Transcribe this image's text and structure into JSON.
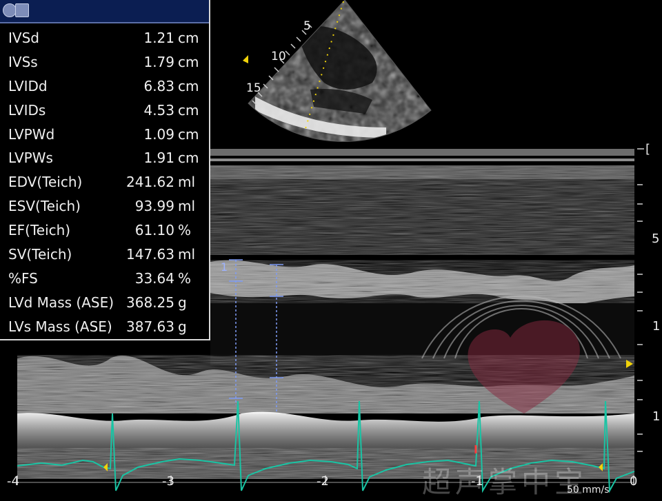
{
  "panel": {
    "header_icon": "report-icon",
    "rows": [
      {
        "label": "IVSd",
        "value": "1.21",
        "unit": "cm"
      },
      {
        "label": "IVSs",
        "value": "1.79",
        "unit": "cm"
      },
      {
        "label": "LVIDd",
        "value": "6.83",
        "unit": "cm"
      },
      {
        "label": "LVIDs",
        "value": "4.53",
        "unit": "cm"
      },
      {
        "label": "LVPWd",
        "value": "1.09",
        "unit": "cm"
      },
      {
        "label": "LVPWs",
        "value": "1.91",
        "unit": "cm"
      },
      {
        "label": "EDV(Teich)",
        "value": "241.62",
        "unit": "ml"
      },
      {
        "label": "ESV(Teich)",
        "value": "93.99",
        "unit": "ml"
      },
      {
        "label": "EF(Teich)",
        "value": "61.10",
        "unit": "%"
      },
      {
        "label": "SV(Teich)",
        "value": "147.63",
        "unit": "ml"
      },
      {
        "label": "%FS",
        "value": "33.64",
        "unit": "%"
      },
      {
        "label": "LVd Mass (ASE)",
        "value": "368.25",
        "unit": "g"
      },
      {
        "label": "LVs Mass (ASE)",
        "value": "387.63",
        "unit": "g"
      }
    ]
  },
  "sector_depth_labels": [
    "5",
    "10",
    "15"
  ],
  "depth_scale_labels": [
    "5",
    "1",
    "1"
  ],
  "time_axis_labels": [
    "-4",
    "-3",
    "-2",
    "-1",
    "0"
  ],
  "sweep_speed": "50 mm/s",
  "caliper_label": "1",
  "watermark_text": "超声掌中宝",
  "colors": {
    "ecg_trace": "#19c4a4",
    "caliper": "#7f9cf5",
    "marker": "#f0d20a",
    "panel_header": "#0b1e52"
  }
}
